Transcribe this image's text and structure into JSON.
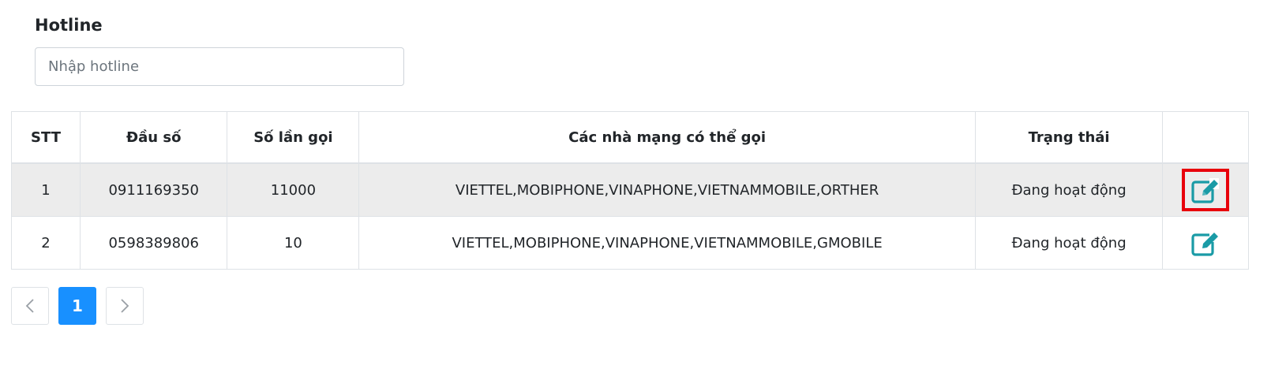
{
  "filter": {
    "label": "Hotline",
    "placeholder": "Nhập hotline",
    "value": ""
  },
  "table": {
    "headers": [
      "STT",
      "Đầu số",
      "Số lần gọi",
      "Các nhà mạng có thể gọi",
      "Trạng thái",
      ""
    ],
    "rows": [
      {
        "stt": "1",
        "dau_so": "0911169350",
        "so_lan_goi": "11000",
        "nha_mang": "VIETTEL,MOBIPHONE,VINAPHONE,VIETNAMMOBILE,ORTHER",
        "trang_thai": "Đang hoạt động",
        "action_icon": "edit-icon",
        "highlighted": true
      },
      {
        "stt": "2",
        "dau_so": "0598389806",
        "so_lan_goi": "10",
        "nha_mang": "VIETTEL,MOBIPHONE,VINAPHONE,VIETNAMMOBILE,GMOBILE",
        "trang_thai": "Đang hoạt động",
        "action_icon": "edit-icon",
        "highlighted": false
      }
    ]
  },
  "pagination": {
    "prev_icon": "chevron-left-icon",
    "current_page": "1",
    "next_icon": "chevron-right-icon"
  },
  "colors": {
    "accent": "#1890ff",
    "icon": "#1a9ba6",
    "highlight_border": "#e8000b",
    "row_alt_bg": "#ececec"
  }
}
